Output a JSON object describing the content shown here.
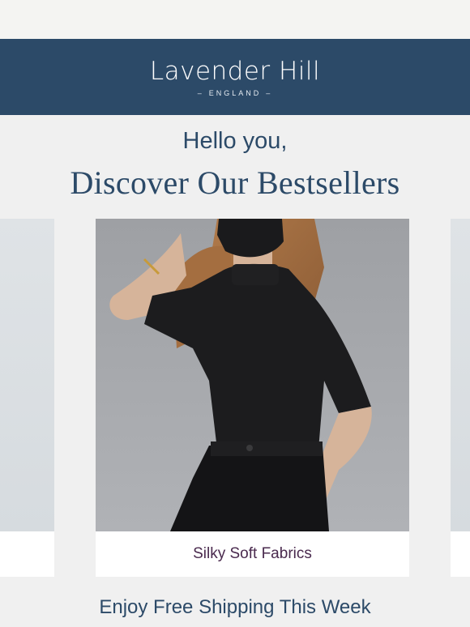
{
  "header": {
    "brand_name": "Lavender Hill",
    "brand_sub": "ENGLAND",
    "brand_color": "#2c4a68"
  },
  "intro": {
    "greeting": "Hello you,",
    "headline": "Discover Our Bestsellers"
  },
  "carousel": {
    "current_item": {
      "caption": "Silky Soft Fabrics",
      "image_description": "model-black-mock-neck-top"
    }
  },
  "footer": {
    "shipping_text": "Enjoy Free Shipping This Week"
  },
  "colors": {
    "background": "#f0f0f0",
    "header_bg": "#2c4a68",
    "caption_text": "#4a2a4e"
  }
}
